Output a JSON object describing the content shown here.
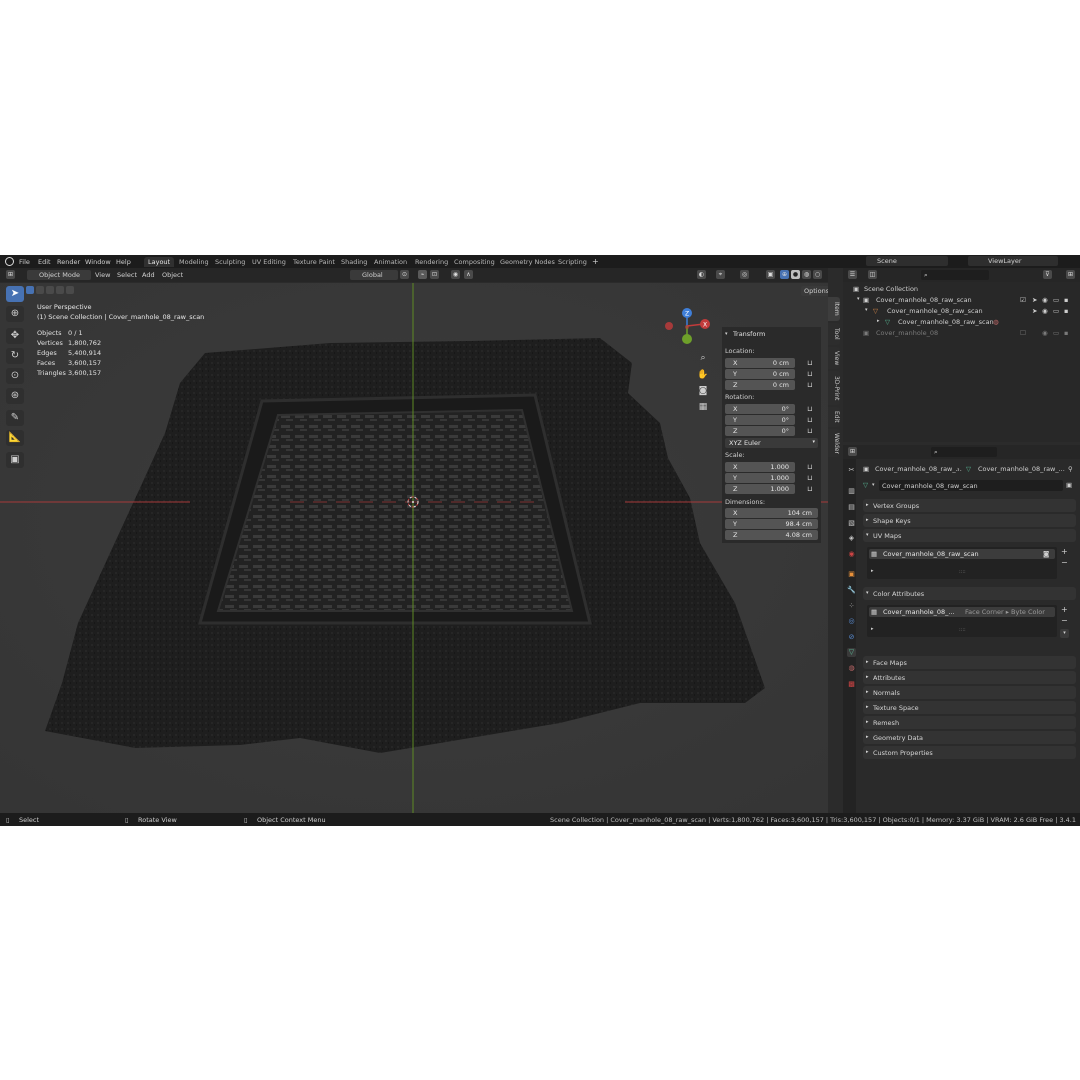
{
  "menu": [
    "File",
    "Edit",
    "Render",
    "Window",
    "Help"
  ],
  "workspace_tabs": [
    {
      "label": "Layout",
      "active": true
    },
    {
      "label": "Modeling"
    },
    {
      "label": "Sculpting"
    },
    {
      "label": "UV Editing"
    },
    {
      "label": "Texture Paint"
    },
    {
      "label": "Shading"
    },
    {
      "label": "Animation"
    },
    {
      "label": "Rendering"
    },
    {
      "label": "Compositing"
    },
    {
      "label": "Geometry Nodes"
    },
    {
      "label": "Scripting"
    }
  ],
  "add_workspace": "+",
  "scene_label": "Scene",
  "viewlayer_label": "ViewLayer",
  "viewport_header": {
    "mode": "Object Mode",
    "menus": [
      "View",
      "Select",
      "Add",
      "Object"
    ],
    "orientation": "Global",
    "options": "Options"
  },
  "viewport": {
    "perspective": "User Perspective",
    "collection_path": "(1) Scene Collection | Cover_manhole_08_raw_scan",
    "stats": [
      {
        "label": "Objects",
        "value": "0 / 1"
      },
      {
        "label": "Vertices",
        "value": "1,800,762"
      },
      {
        "label": "Edges",
        "value": "5,400,914"
      },
      {
        "label": "Faces",
        "value": "3,600,157"
      },
      {
        "label": "Triangles",
        "value": "3,600,157"
      }
    ]
  },
  "npanel": {
    "title": "Transform",
    "location_label": "Location:",
    "location": [
      {
        "axis": "X",
        "value": "0 cm"
      },
      {
        "axis": "Y",
        "value": "0 cm"
      },
      {
        "axis": "Z",
        "value": "0 cm"
      }
    ],
    "rotation_label": "Rotation:",
    "rotation": [
      {
        "axis": "X",
        "value": "0°"
      },
      {
        "axis": "Y",
        "value": "0°"
      },
      {
        "axis": "Z",
        "value": "0°"
      }
    ],
    "rotation_mode": "XYZ Euler",
    "scale_label": "Scale:",
    "scale": [
      {
        "axis": "X",
        "value": "1.000"
      },
      {
        "axis": "Y",
        "value": "1.000"
      },
      {
        "axis": "Z",
        "value": "1.000"
      }
    ],
    "dimensions_label": "Dimensions:",
    "dimensions": [
      {
        "axis": "X",
        "value": "104 cm"
      },
      {
        "axis": "Y",
        "value": "98.4 cm"
      },
      {
        "axis": "Z",
        "value": "4.08 cm"
      }
    ]
  },
  "side_tabs": [
    "Item",
    "Tool",
    "View",
    "3D-Print",
    "Edit",
    "Welder"
  ],
  "outliner": {
    "root": "Scene Collection",
    "rows": [
      "Cover_manhole_08_raw_scan",
      "Cover_manhole_08_raw_scan",
      "Cover_manhole_08_raw_scan",
      "Cover_manhole_08"
    ]
  },
  "properties": {
    "breadcrumb_object": "Cover_manhole_08_raw_...",
    "breadcrumb_mesh": "Cover_manhole_08_raw_...",
    "mesh_name": "Cover_manhole_08_raw_scan",
    "sections": {
      "vertex_groups": "Vertex Groups",
      "shape_keys": "Shape Keys",
      "uv_maps": "UV Maps",
      "color_attributes": "Color Attributes",
      "face_maps": "Face Maps",
      "attributes": "Attributes",
      "normals": "Normals",
      "texture_space": "Texture Space",
      "remesh": "Remesh",
      "geometry_data": "Geometry Data",
      "custom_properties": "Custom Properties"
    },
    "uv_map_item": "Cover_manhole_08_raw_scan",
    "color_attr_item": "Cover_manhole_08_...",
    "color_attr_domain": "Face Corner ▸ Byte Color"
  },
  "statusbar": {
    "select": "Select",
    "rotate": "Rotate View",
    "context": "Object Context Menu",
    "info": "Scene Collection | Cover_manhole_08_raw_scan | Verts:1,800,762 | Faces:3,600,157 | Tris:3,600,157 | Objects:0/1 | Memory: 3.37 GiB | VRAM: 2.6 GiB Free | 3.4.1"
  },
  "colors": {
    "accent": "#4772b3",
    "x_axis": "#c23b3b",
    "y_axis": "#6ea02a",
    "z_axis": "#3f7fd9"
  }
}
